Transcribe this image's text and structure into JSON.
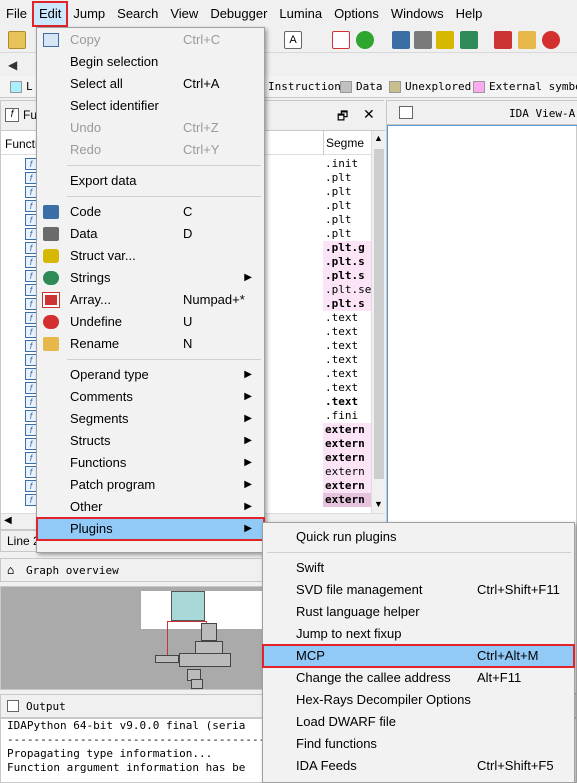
{
  "menubar": {
    "items": [
      "File",
      "Edit",
      "Jump",
      "Search",
      "View",
      "Debugger",
      "Lumina",
      "Options",
      "Windows",
      "Help"
    ]
  },
  "legend": {
    "items": [
      {
        "label": "Instruction",
        "color": "#ffffff"
      },
      {
        "label": "Data",
        "color": "#c0c0c0"
      },
      {
        "label": "Unexplored",
        "color": "#c8c08c"
      },
      {
        "label": "External symbol",
        "color": "#ffaaee"
      }
    ],
    "l_label": "L"
  },
  "functions_panel": {
    "title_letter": "Fu",
    "col_function": "Functi",
    "col_segment": "Segme",
    "segments": [
      {
        "name": ".init",
        "style": ""
      },
      {
        "name": ".plt",
        "style": ""
      },
      {
        "name": ".plt",
        "style": ""
      },
      {
        "name": ".plt",
        "style": ""
      },
      {
        "name": ".plt",
        "style": ""
      },
      {
        "name": ".plt",
        "style": ""
      },
      {
        "name": ".plt.g",
        "style": "pink bold"
      },
      {
        "name": ".plt.s",
        "style": "pink bold"
      },
      {
        "name": ".plt.s",
        "style": "pink bold"
      },
      {
        "name": ".plt.se",
        "style": "pink"
      },
      {
        "name": ".plt.s",
        "style": "pink bold"
      },
      {
        "name": ".text",
        "style": ""
      },
      {
        "name": ".text",
        "style": ""
      },
      {
        "name": ".text",
        "style": ""
      },
      {
        "name": ".text",
        "style": ""
      },
      {
        "name": ".text",
        "style": ""
      },
      {
        "name": ".text",
        "style": ""
      },
      {
        "name": ".text",
        "style": "bold"
      },
      {
        "name": ".fini",
        "style": ""
      },
      {
        "name": "extern",
        "style": "pink bold"
      },
      {
        "name": "extern",
        "style": "pink bold"
      },
      {
        "name": "extern",
        "style": "pink bold"
      },
      {
        "name": "extern",
        "style": "pink"
      },
      {
        "name": "extern",
        "style": "pink bold"
      },
      {
        "name": "extern",
        "style": "sel bold"
      }
    ]
  },
  "ida_view": {
    "title": "IDA View-A"
  },
  "line_strip": {
    "text": "Line 2"
  },
  "graph_overview": {
    "title": "Graph overview"
  },
  "output": {
    "title": "Output",
    "lines": [
      "IDAPython 64-bit v9.0.0 final (seria",
      "----------------------------------------",
      "Propagating type information...",
      "Function argument information has be"
    ]
  },
  "edit_menu": {
    "items": [
      {
        "type": "item",
        "label": "Copy",
        "shortcut": "Ctrl+C",
        "disabled": true,
        "icon": "copy-icon"
      },
      {
        "type": "item",
        "label": "Begin selection",
        "shortcut": "",
        "disabled": false
      },
      {
        "type": "item",
        "label": "Select all",
        "shortcut": "Ctrl+A",
        "disabled": false
      },
      {
        "type": "item",
        "label": "Select identifier",
        "shortcut": "",
        "disabled": false
      },
      {
        "type": "item",
        "label": "Undo",
        "shortcut": "Ctrl+Z",
        "disabled": true
      },
      {
        "type": "item",
        "label": "Redo",
        "shortcut": "Ctrl+Y",
        "disabled": true
      },
      {
        "type": "sep"
      },
      {
        "type": "item",
        "label": "Export data",
        "shortcut": "",
        "disabled": false
      },
      {
        "type": "sep"
      },
      {
        "type": "item",
        "label": "Code",
        "shortcut": "C",
        "disabled": false,
        "icon": "code-icon"
      },
      {
        "type": "item",
        "label": "Data",
        "shortcut": "D",
        "disabled": false,
        "icon": "data-icon"
      },
      {
        "type": "item",
        "label": "Struct var...",
        "shortcut": "",
        "disabled": false,
        "icon": "struct-icon"
      },
      {
        "type": "item",
        "label": "Strings",
        "shortcut": "",
        "disabled": false,
        "submenu": true,
        "icon": "strings-icon"
      },
      {
        "type": "item",
        "label": "Array...",
        "shortcut": "Numpad+*",
        "disabled": false,
        "icon": "array-icon"
      },
      {
        "type": "item",
        "label": "Undefine",
        "shortcut": "U",
        "disabled": false,
        "icon": "undefine-icon"
      },
      {
        "type": "item",
        "label": "Rename",
        "shortcut": "N",
        "disabled": false,
        "icon": "rename-icon"
      },
      {
        "type": "sep"
      },
      {
        "type": "item",
        "label": "Operand type",
        "shortcut": "",
        "disabled": false,
        "submenu": true
      },
      {
        "type": "item",
        "label": "Comments",
        "shortcut": "",
        "disabled": false,
        "submenu": true
      },
      {
        "type": "item",
        "label": "Segments",
        "shortcut": "",
        "disabled": false,
        "submenu": true
      },
      {
        "type": "item",
        "label": "Structs",
        "shortcut": "",
        "disabled": false,
        "submenu": true
      },
      {
        "type": "item",
        "label": "Functions",
        "shortcut": "",
        "disabled": false,
        "submenu": true
      },
      {
        "type": "item",
        "label": "Patch program",
        "shortcut": "",
        "disabled": false,
        "submenu": true
      },
      {
        "type": "item",
        "label": "Other",
        "shortcut": "",
        "disabled": false,
        "submenu": true
      },
      {
        "type": "item",
        "label": "Plugins",
        "shortcut": "",
        "disabled": false,
        "submenu": true,
        "highlight": true
      }
    ]
  },
  "plugins_menu": {
    "items": [
      {
        "type": "item",
        "label": "Quick run plugins",
        "shortcut": ""
      },
      {
        "type": "sep"
      },
      {
        "type": "item",
        "label": "Swift",
        "shortcut": ""
      },
      {
        "type": "item",
        "label": "SVD file management",
        "shortcut": "Ctrl+Shift+F11"
      },
      {
        "type": "item",
        "label": "Rust language helper",
        "shortcut": ""
      },
      {
        "type": "item",
        "label": "Jump to next fixup",
        "shortcut": ""
      },
      {
        "type": "item",
        "label": "MCP",
        "shortcut": "Ctrl+Alt+M",
        "highlight": true
      },
      {
        "type": "item",
        "label": "Change the callee address",
        "shortcut": "Alt+F11"
      },
      {
        "type": "item",
        "label": "Hex-Rays Decompiler Options",
        "shortcut": ""
      },
      {
        "type": "item",
        "label": "Load DWARF file",
        "shortcut": ""
      },
      {
        "type": "item",
        "label": "Find functions",
        "shortcut": ""
      },
      {
        "type": "item",
        "label": "IDA Feeds",
        "shortcut": "Ctrl+Shift+F5"
      }
    ]
  },
  "colors": {
    "highlight": "#91c9f7",
    "callout_red": "#e0242a",
    "menubar_active": "#cce8ff",
    "ida_blue_border": "#5b9bd5"
  }
}
